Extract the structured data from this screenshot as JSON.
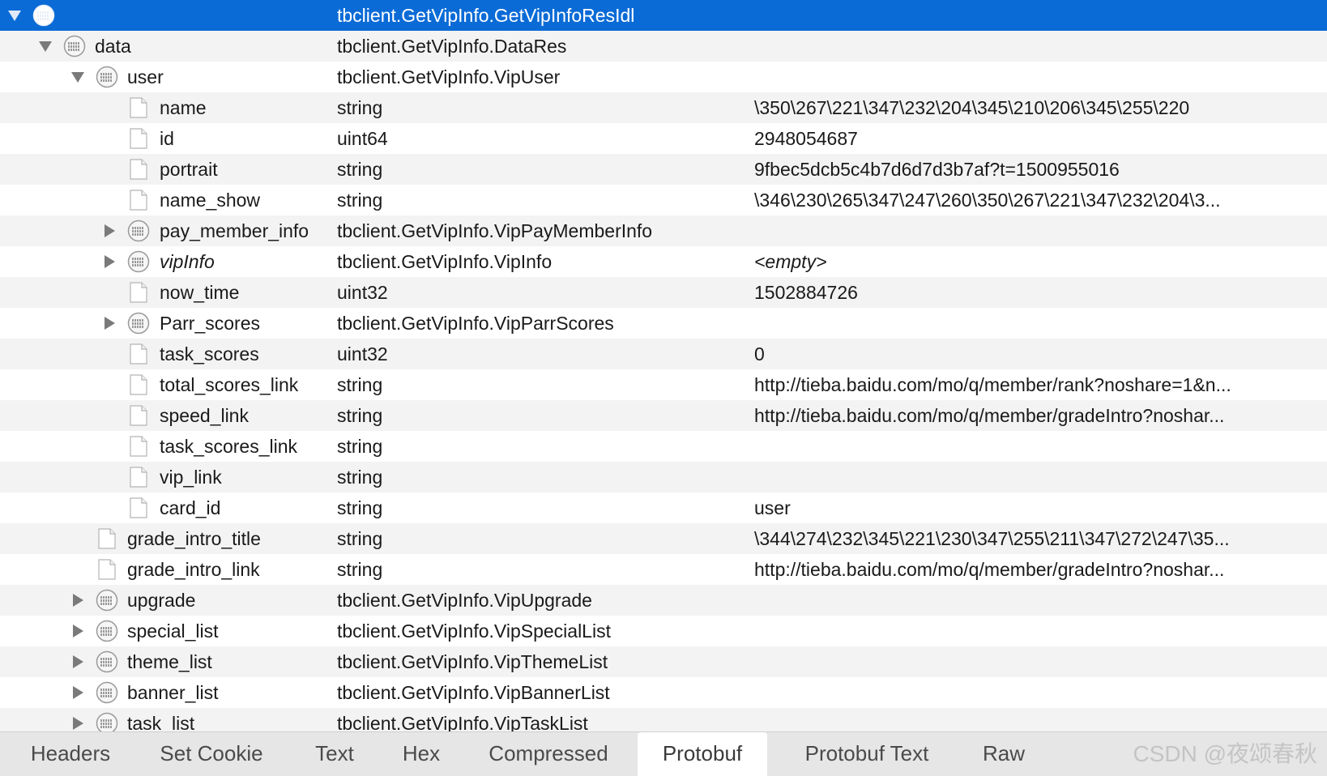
{
  "tree": {
    "rows": [
      {
        "name": "",
        "type": "tbclient.GetVipInfo.GetVipInfoResIdl",
        "value": "",
        "icon": "message-icon",
        "expand": "expanded",
        "selected": true
      },
      {
        "name": "data",
        "type": "tbclient.GetVipInfo.DataRes",
        "value": "",
        "icon": "message-icon",
        "expand": "expanded"
      },
      {
        "name": "user",
        "type": "tbclient.GetVipInfo.VipUser",
        "value": "",
        "icon": "message-icon",
        "expand": "expanded"
      },
      {
        "name": "name",
        "type": "string",
        "value": "\\350\\267\\221\\347\\232\\204\\345\\210\\206\\345\\255\\220",
        "icon": "file-icon"
      },
      {
        "name": "id",
        "type": "uint64",
        "value": "2948054687",
        "icon": "file-icon"
      },
      {
        "name": "portrait",
        "type": "string",
        "value": "9fbec5dcb5c4b7d6d7d3b7af?t=1500955016",
        "icon": "file-icon"
      },
      {
        "name": "name_show",
        "type": "string",
        "value": "\\346\\230\\265\\347\\247\\260\\350\\267\\221\\347\\232\\204\\3...",
        "icon": "file-icon"
      },
      {
        "name": "pay_member_info",
        "type": "tbclient.GetVipInfo.VipPayMemberInfo",
        "value": "",
        "icon": "message-icon",
        "expand": "collapsed"
      },
      {
        "name": "vipInfo",
        "type": "tbclient.GetVipInfo.VipInfo",
        "value": "<empty>",
        "icon": "message-icon",
        "expand": "collapsed",
        "italic": true
      },
      {
        "name": "now_time",
        "type": "uint32",
        "value": "1502884726",
        "icon": "file-icon"
      },
      {
        "name": "Parr_scores",
        "type": "tbclient.GetVipInfo.VipParrScores",
        "value": "",
        "icon": "message-icon",
        "expand": "collapsed"
      },
      {
        "name": "task_scores",
        "type": "uint32",
        "value": "0",
        "icon": "file-icon"
      },
      {
        "name": "total_scores_link",
        "type": "string",
        "value": "http://tieba.baidu.com/mo/q/member/rank?noshare=1&n...",
        "icon": "file-icon"
      },
      {
        "name": "speed_link",
        "type": "string",
        "value": "http://tieba.baidu.com/mo/q/member/gradeIntro?noshar...",
        "icon": "file-icon"
      },
      {
        "name": "task_scores_link",
        "type": "string",
        "value": "",
        "icon": "file-icon"
      },
      {
        "name": "vip_link",
        "type": "string",
        "value": "",
        "icon": "file-icon"
      },
      {
        "name": "card_id",
        "type": "string",
        "value": "user",
        "icon": "file-icon"
      },
      {
        "name": "grade_intro_title",
        "type": "string",
        "value": "\\344\\274\\232\\345\\221\\230\\347\\255\\211\\347\\272\\247\\35...",
        "icon": "file-icon"
      },
      {
        "name": "grade_intro_link",
        "type": "string",
        "value": "http://tieba.baidu.com/mo/q/member/gradeIntro?noshar...",
        "icon": "file-icon"
      },
      {
        "name": "upgrade",
        "type": "tbclient.GetVipInfo.VipUpgrade",
        "value": "",
        "icon": "message-icon",
        "expand": "collapsed"
      },
      {
        "name": "special_list",
        "type": "tbclient.GetVipInfo.VipSpecialList",
        "value": "",
        "icon": "message-icon",
        "expand": "collapsed"
      },
      {
        "name": "theme_list",
        "type": "tbclient.GetVipInfo.VipThemeList",
        "value": "",
        "icon": "message-icon",
        "expand": "collapsed"
      },
      {
        "name": "banner_list",
        "type": "tbclient.GetVipInfo.VipBannerList",
        "value": "",
        "icon": "message-icon",
        "expand": "collapsed"
      },
      {
        "name": "task_list",
        "type": "tbclient.GetVipInfo.VipTaskList",
        "value": "",
        "icon": "message-icon",
        "expand": "collapsed"
      }
    ]
  },
  "tabs": {
    "items": [
      {
        "label": "Headers"
      },
      {
        "label": "Set Cookie"
      },
      {
        "label": "Text"
      },
      {
        "label": "Hex"
      },
      {
        "label": "Compressed"
      },
      {
        "label": "Protobuf",
        "active": true
      },
      {
        "label": "Protobuf Text"
      },
      {
        "label": "Raw"
      }
    ]
  },
  "watermark": "CSDN @夜颂春秋",
  "colors": {
    "selection": "#0a6bd6",
    "stripe": "#f3f3f3",
    "tabbar": "#e6e6e6"
  }
}
